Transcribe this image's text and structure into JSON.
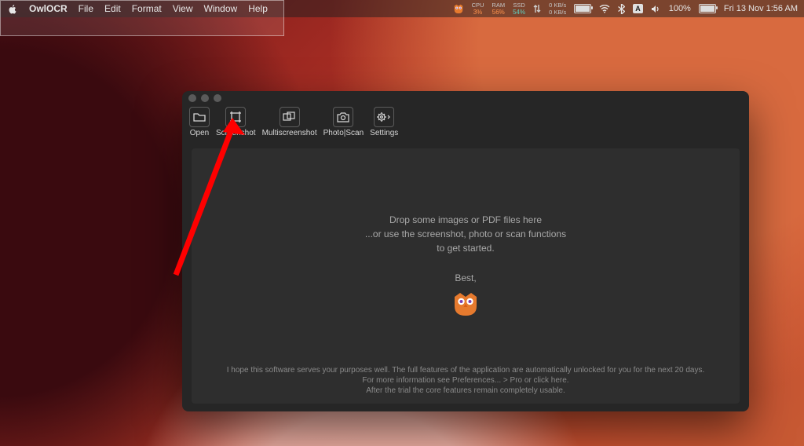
{
  "menubar": {
    "appName": "OwlOCR",
    "items": [
      "File",
      "Edit",
      "Format",
      "View",
      "Window",
      "Help"
    ],
    "status": {
      "cpuLabel": "CPU",
      "cpuVal": "3%",
      "ramLabel": "RAM",
      "ramVal": "56%",
      "ssdLabel": "SSD",
      "ssdVal": "54%",
      "netUp": "0 KB/s",
      "netDown": "0 KB/s",
      "inputBadge": "A",
      "batteryPct": "100%",
      "clock": "Fri 13 Nov  1:56 AM"
    }
  },
  "window": {
    "toolbar": {
      "open": "Open",
      "screenshot": "Screenshot",
      "multiscreenshot": "Multiscreenshot",
      "photoscan": "Photo|Scan",
      "settings": "Settings"
    },
    "drop": {
      "line1": "Drop some images or PDF files here",
      "line2": "...or use the screenshot, photo or scan functions",
      "line3": "to get started.",
      "best": "Best,"
    },
    "footer": {
      "l1": "I hope this software serves your purposes well. The full features of the application are automatically unlocked for you for the next 20 days.",
      "l2": "For more information see Preferences... > Pro or click here.",
      "l3": "After the trial the core features remain completely usable."
    }
  }
}
